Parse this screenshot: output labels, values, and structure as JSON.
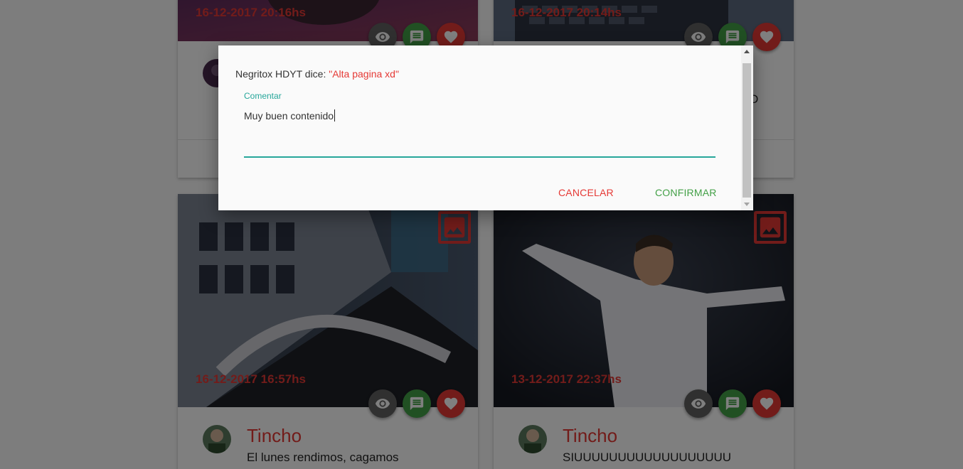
{
  "feed": {
    "cards": [
      {
        "date": "16-12-2017 20:16hs"
      },
      {
        "date": "16-12-2017 20:14hs",
        "text_fragment": "D"
      },
      {
        "date": "16-12-2017 16:57hs",
        "author": "Tincho",
        "text": "El lunes rendimos, cagamos"
      },
      {
        "date": "13-12-2017 22:37hs",
        "author": "Tincho",
        "text": "SIUUUUUUUUUUUUUUUUUU"
      }
    ],
    "icons": {
      "view": "eye-icon",
      "comment": "comment-icon",
      "like": "heart-icon",
      "media": "image-icon"
    }
  },
  "dialog": {
    "author": "Negritox HDYT",
    "says": "dice:",
    "quote": "\"Alta pagina xd\"",
    "field_label": "Comentar",
    "field_value": "Muy buen contenido",
    "cancel_label": "CANCELAR",
    "confirm_label": "CONFIRMAR"
  },
  "colors": {
    "accent_red": "#e53935",
    "accent_green": "#43a047",
    "accent_teal": "#26a69a",
    "fab_grey": "#616161"
  }
}
